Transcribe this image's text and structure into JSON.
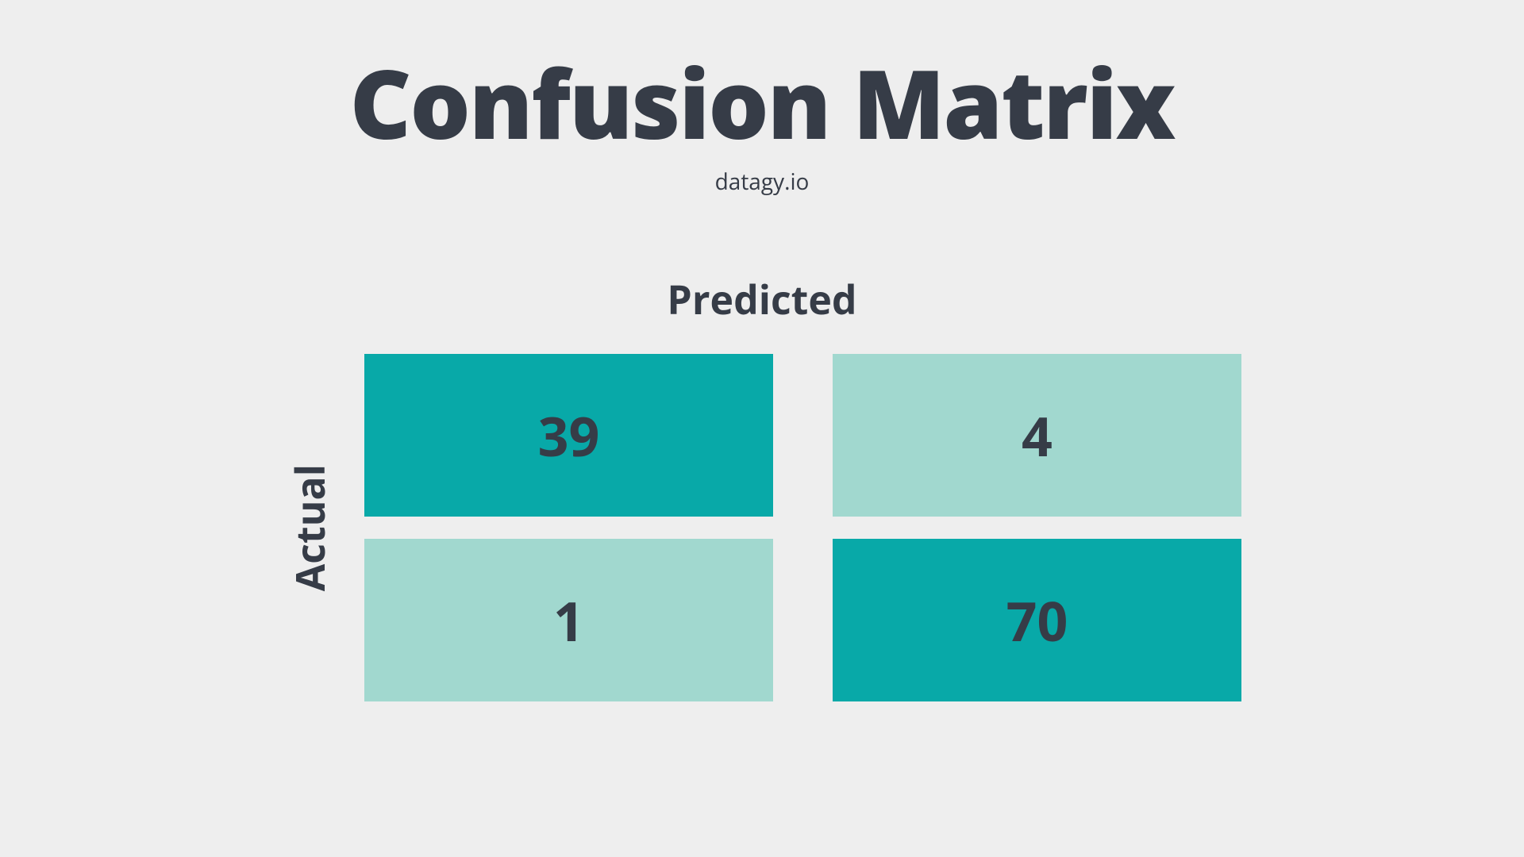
{
  "title": "Confusion Matrix",
  "subtitle": "datagy.io",
  "column_label": "Predicted",
  "row_label": "Actual",
  "matrix": {
    "top_left": "39",
    "top_right": "4",
    "bottom_left": "1",
    "bottom_right": "70"
  },
  "colors": {
    "background": "#eeeeee",
    "text": "#363c47",
    "cell_dark": "#08a9a8",
    "cell_light": "#a1d8cf"
  }
}
